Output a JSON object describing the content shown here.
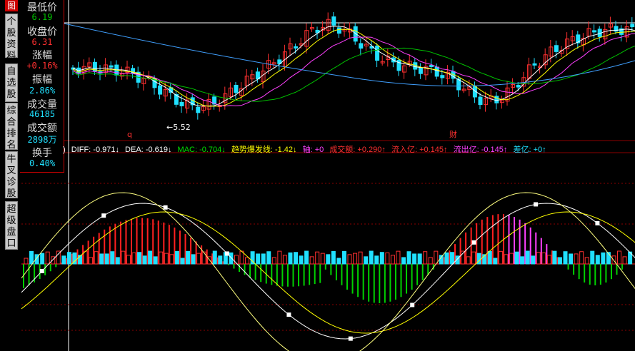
{
  "toolbar": {
    "active_icon": "图",
    "buttons": [
      "个股资料",
      "自选股",
      "综合排名",
      "牛叉诊股",
      "超级盘口"
    ]
  },
  "info_panel": {
    "items": [
      {
        "label": "最低价",
        "value": "6.19",
        "color": "#00c000"
      },
      {
        "label": "收盘价",
        "value": "6.31",
        "color": "#ff3030"
      },
      {
        "label": "涨幅",
        "value": "+0.16%",
        "color": "#ff3030"
      },
      {
        "label": "振幅",
        "value": "2.86%",
        "color": "#20e0ff"
      },
      {
        "label": "成交量",
        "value": "46185",
        "color": "#20e0ff"
      },
      {
        "label": "成交额",
        "value": "2898万",
        "color": "#20e0ff"
      },
      {
        "label": "换手",
        "value": "0.40%",
        "color": "#20e0ff"
      }
    ]
  },
  "price_chart": {
    "low_marker_label": "←5.52",
    "markers": [
      "q",
      "财"
    ]
  },
  "legend": [
    {
      "text": ")",
      "color": "#ffffff"
    },
    {
      "text": "DIFF: -0.971↓",
      "color": "#ffffff"
    },
    {
      "text": "DEA: -0.619↓",
      "color": "#ffffff"
    },
    {
      "text": "MAC: -0.704↓",
      "color": "#00e000"
    },
    {
      "text": "趋势爆发线: -1.42↓",
      "color": "#ffff00"
    },
    {
      "text": "轴: +0",
      "color": "#ff40ff"
    },
    {
      "text": "成交额: +0.290↑",
      "color": "#ff3030"
    },
    {
      "text": "流入亿: +0.145↑",
      "color": "#ff3030"
    },
    {
      "text": "流出亿: -0.145↑",
      "color": "#ff40ff"
    },
    {
      "text": "差亿: +0↑",
      "color": "#20e0ff"
    }
  ],
  "colors": {
    "up": "#ff3030",
    "down": "#20e0ff",
    "macd_up": "#ff2020",
    "macd_down": "#00d000",
    "grid": "#8b0000"
  }
}
